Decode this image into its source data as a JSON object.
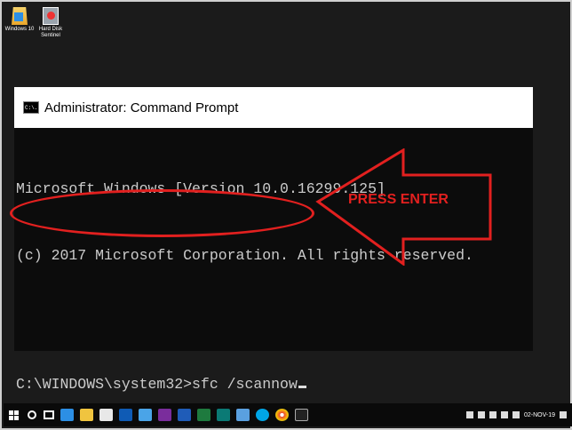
{
  "desktop": {
    "icons": [
      {
        "label": "Windows 10",
        "glyph": "folder-icon"
      },
      {
        "label": "Hard Disk Sentinel",
        "glyph": "hard-disk-sentinel-icon"
      }
    ]
  },
  "window": {
    "title": "Administrator: Command Prompt",
    "icon_text": "C:\\."
  },
  "console": {
    "lines": [
      "Microsoft Windows [Version 10.0.16299.125]",
      "(c) 2017 Microsoft Corporation. All rights reserved."
    ],
    "prompt": "C:\\WINDOWS\\system32>sfc /scannow"
  },
  "annotation": {
    "label": "PRESS ENTER",
    "color": "#e2201f"
  },
  "taskbar": {
    "apps": [
      "explorer-icon",
      "edge-icon",
      "store-icon",
      "store-bag-icon",
      "outlook-icon",
      "onenote-icon",
      "onenote-icon",
      "word-icon",
      "excel-icon",
      "publisher-icon",
      "sticky-notes-icon",
      "skype-icon",
      "chrome-icon",
      "cmd-icon"
    ],
    "date": "02-NOV-19"
  }
}
